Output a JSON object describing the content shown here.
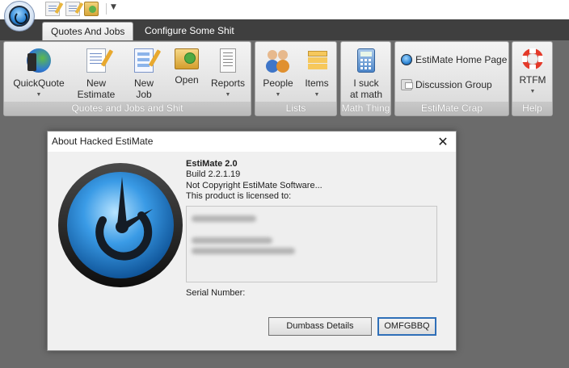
{
  "quick_access": {
    "buttons": [
      "new-estimate",
      "new-job",
      "open"
    ]
  },
  "tabs": [
    {
      "label": "Quotes And Jobs",
      "active": true
    },
    {
      "label": "Configure Some Shit",
      "active": false
    }
  ],
  "ribbon": {
    "groups": [
      {
        "label": "Quotes and Jobs and Shit",
        "buttons": [
          {
            "label": "QuickQuote",
            "icon": "quickquote-icon",
            "dropdown": true
          },
          {
            "label": "New\nEstimate",
            "icon": "new-estimate-icon",
            "dropdown": false
          },
          {
            "label": "New\nJob",
            "icon": "new-job-icon",
            "dropdown": false
          },
          {
            "label": "Open",
            "icon": "open-folder-icon",
            "dropdown": false
          },
          {
            "label": "Reports",
            "icon": "reports-icon",
            "dropdown": true
          }
        ]
      },
      {
        "label": "Lists",
        "buttons": [
          {
            "label": "People",
            "icon": "people-icon",
            "dropdown": true
          },
          {
            "label": "Items",
            "icon": "items-icon",
            "dropdown": true
          }
        ]
      },
      {
        "label": "Math Thing",
        "buttons": [
          {
            "label": "I suck\nat math",
            "icon": "calculator-icon",
            "dropdown": false
          }
        ]
      },
      {
        "label": "EstiMate Crap",
        "rows": [
          {
            "label": "EstiMate Home Page",
            "icon": "home-page-icon"
          },
          {
            "label": "Discussion Group",
            "icon": "discussion-icon"
          }
        ]
      },
      {
        "label": "Help",
        "buttons": [
          {
            "label": "RTFM",
            "icon": "lifebuoy-icon",
            "dropdown": true
          }
        ]
      }
    ]
  },
  "dialog": {
    "title": "About Hacked EstiMate",
    "close_glyph": "✕",
    "product_name": "EstiMate 2.0",
    "build": "Build 2.2.1.19",
    "copyright": "Not Copyright EstiMate Software...",
    "licensed_to": "This product is licensed to:",
    "serial_label": "Serial Number:",
    "details_button": "Dumbass Details",
    "ok_button": "OMFGBBQ"
  },
  "colors": {
    "app_background": "#6b6b6b",
    "tab_bar": "#3f3f3f",
    "ok_button_border": "#2f6fb8",
    "logo_blue": "#2f86d4"
  }
}
